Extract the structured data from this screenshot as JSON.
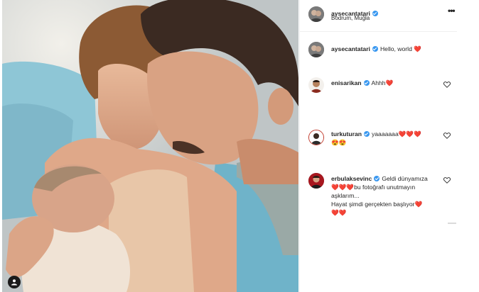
{
  "post": {
    "author": "aysecantatari",
    "location": "Bodrum, Muğla",
    "caption": "Hello, world ❤️"
  },
  "comments": [
    {
      "user": "enisarikan",
      "text": "Ahhh❤️"
    },
    {
      "user": "turkuturan",
      "text": "yaaaaaaa❤️❤️❤️",
      "line2": "😍😍"
    },
    {
      "user": "erbulaksevinc",
      "text": "Geldi dünyamıza",
      "line2": "❤️❤️❤️bu fotoğrafı unutmayın",
      "line3": "aşklarım...",
      "line4": "Hayat şimdi gerçekten başlıyor❤️",
      "line5": "❤️❤️"
    }
  ],
  "icons": {
    "more": "more-options-icon",
    "like": "heart-outline-icon",
    "tag": "user-tag-icon",
    "verified": "verified-badge-icon"
  },
  "colors": {
    "verified": "#3897f0",
    "heart": "#e0102a"
  }
}
